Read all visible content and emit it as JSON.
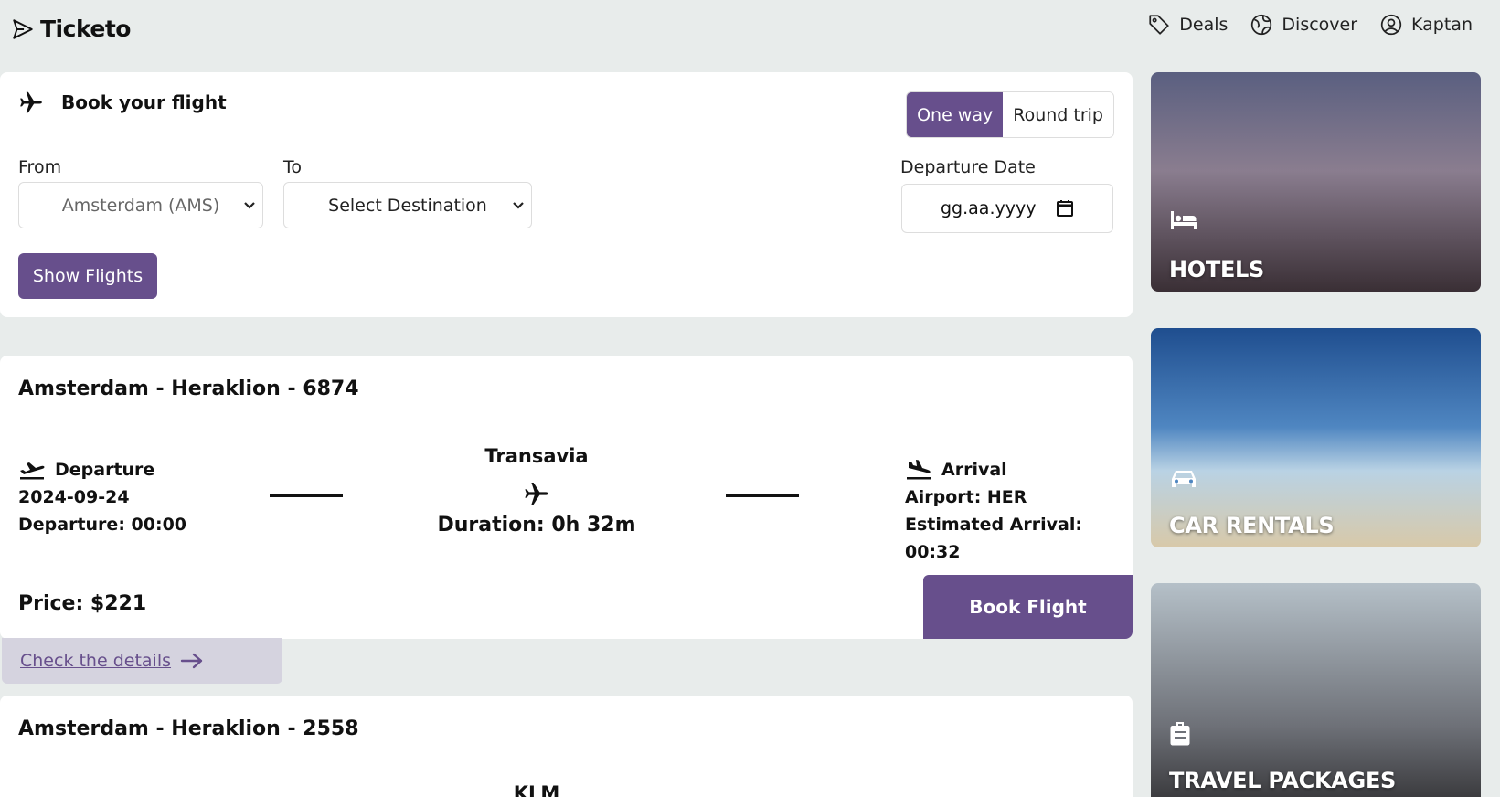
{
  "brand": {
    "name": "Ticketo"
  },
  "nav": {
    "deals": "Deals",
    "discover": "Discover",
    "account": "Kaptan"
  },
  "booking": {
    "title": "Book your flight",
    "one_way": "One way",
    "round_trip": "Round trip",
    "from_label": "From",
    "from_value": "Amsterdam (AMS)",
    "to_label": "To",
    "to_value": "Select Destination",
    "date_label": "Departure Date",
    "date_placeholder": "gg.aa.yyyy",
    "show_flights": "Show Flights"
  },
  "flights": [
    {
      "title": "Amsterdam - Heraklion - 6874",
      "departure_label": "Departure",
      "date": "2024-09-24",
      "departure_time": "Departure: 00:00",
      "carrier": "Transavia",
      "duration": "Duration: 0h 32m",
      "arrival_label": "Arrival",
      "airport": "Airport: HER",
      "arrival_time": "Estimated Arrival: 00:32",
      "price": "Price: $221",
      "book": "Book Flight",
      "details": "Check the details"
    },
    {
      "title": "Amsterdam - Heraklion - 2558",
      "carrier": "KLM"
    }
  ],
  "promos": {
    "hotels": "HOTELS",
    "cars": "CAR RENTALS",
    "travel": "TRAVEL PACKAGES"
  },
  "colors": {
    "accent": "#674f8c",
    "background": "#e8eceb",
    "details_bg": "#d5d3df"
  }
}
